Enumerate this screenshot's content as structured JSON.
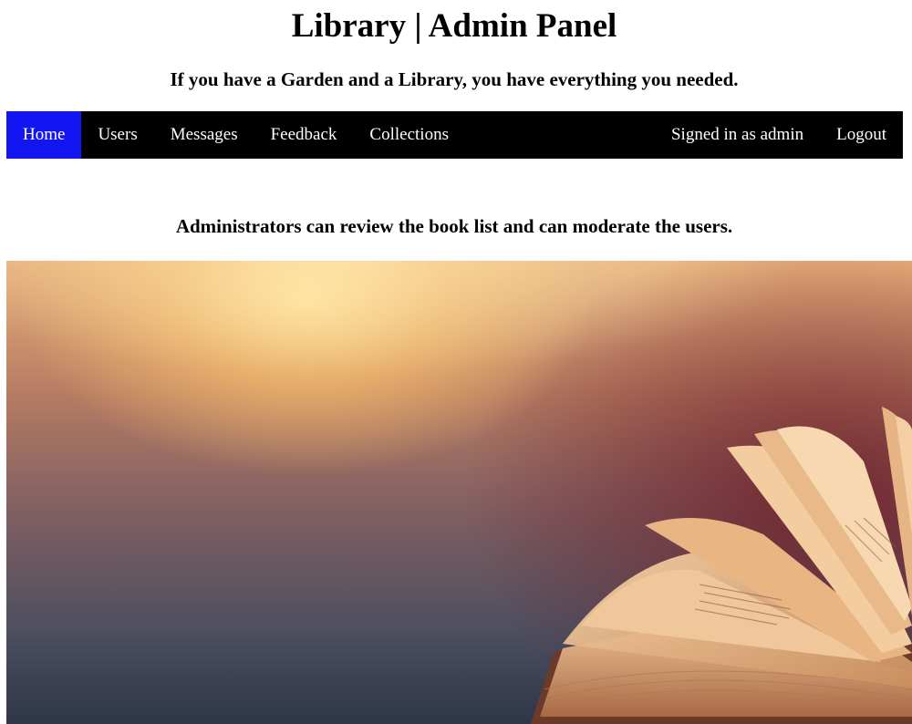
{
  "header": {
    "title": "Library | Admin Panel",
    "tagline": "If you have a Garden and a Library, you have everything you needed."
  },
  "nav": {
    "left_items": [
      {
        "label": "Home",
        "active": true
      },
      {
        "label": "Users",
        "active": false
      },
      {
        "label": "Messages",
        "active": false
      },
      {
        "label": "Feedback",
        "active": false
      },
      {
        "label": "Collections",
        "active": false
      }
    ],
    "signed_in_label": "Signed in as admin",
    "logout_label": "Logout"
  },
  "main": {
    "intro": "Administrators can review the book list and can moderate the users."
  },
  "hero": {
    "image": "open-book-photo"
  },
  "colors": {
    "nav_background": "#000000",
    "nav_active": "#1416f2",
    "nav_text": "#ffffff"
  }
}
